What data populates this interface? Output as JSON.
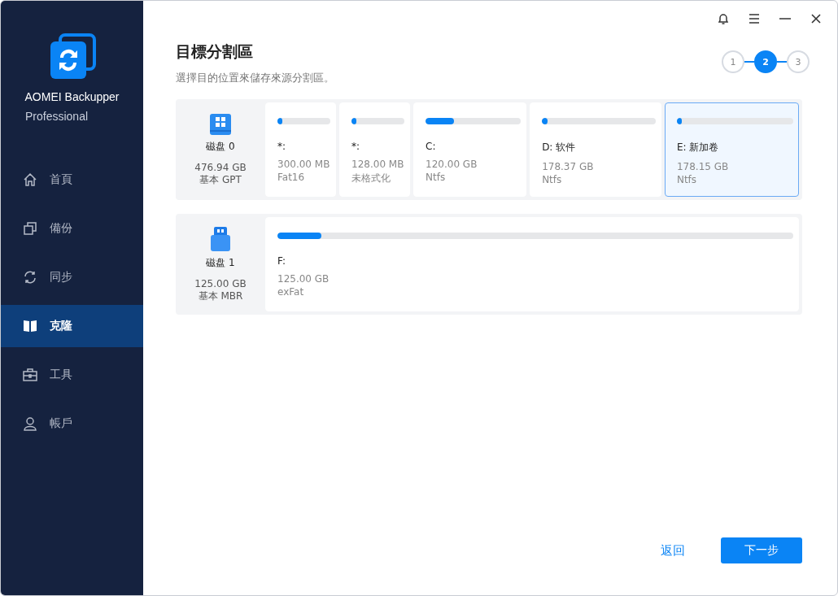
{
  "app": {
    "name": "AOMEI Backupper",
    "edition": "Professional"
  },
  "sidebar": {
    "items": [
      {
        "kind": "home",
        "label": "首頁",
        "selected": false
      },
      {
        "kind": "backup",
        "label": "備份",
        "selected": false
      },
      {
        "kind": "sync",
        "label": "同步",
        "selected": false
      },
      {
        "kind": "clone",
        "label": "克隆",
        "selected": true
      },
      {
        "kind": "tools",
        "label": "工具",
        "selected": false
      },
      {
        "kind": "account",
        "label": "帳戶",
        "selected": false
      }
    ]
  },
  "page": {
    "title": "目標分割區",
    "subtitle": "選擇目的位置來儲存來源分割區。"
  },
  "steps": [
    {
      "label": "1",
      "selected": false
    },
    {
      "label": "2",
      "selected": true
    },
    {
      "label": "3",
      "selected": false
    }
  ],
  "disks": [
    {
      "kind": "hdd",
      "name": "磁盘 0",
      "size": "476.94 GB",
      "type": "基本 GPT",
      "partitions": [
        {
          "name": "*:",
          "size": "300.00 MB",
          "fs": "Fat16",
          "level": 0.05,
          "selected": false
        },
        {
          "name": "*:",
          "size": "128.00 MB",
          "fs": "未格式化",
          "level": 0.05,
          "selected": false
        },
        {
          "name": "C:",
          "size": "120.00 GB",
          "fs": "Ntfs",
          "level": 0.3,
          "selected": false
        },
        {
          "name": "D: 软件",
          "size": "178.37 GB",
          "fs": "Ntfs",
          "level": 0.05,
          "selected": false
        },
        {
          "name": "E: 新加卷",
          "size": "178.15 GB",
          "fs": "Ntfs",
          "level": 0.03,
          "selected": true
        }
      ]
    },
    {
      "kind": "usb",
      "name": "磁盘 1",
      "size": "125.00 GB",
      "type": "基本 MBR",
      "partitions": [
        {
          "name": "F:",
          "size": "125.00 GB",
          "fs": "exFat",
          "level": 0.085,
          "selected": false
        }
      ]
    }
  ],
  "buttons": {
    "back": "返回",
    "next": "下一步"
  }
}
